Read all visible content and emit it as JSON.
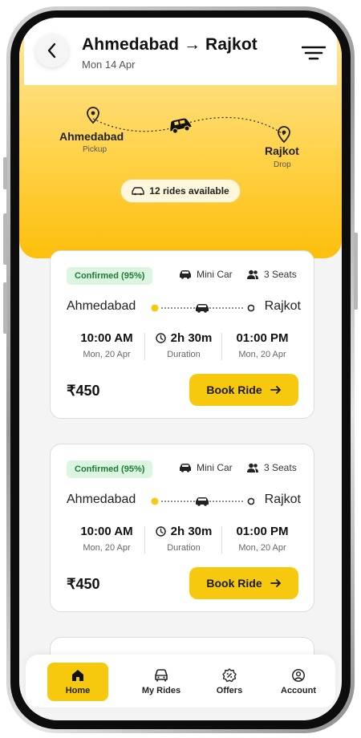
{
  "header": {
    "title": "Ahmedabad → Rajkot",
    "date": "Mon 14 Apr"
  },
  "route_map": {
    "from_city": "Ahmedabad",
    "from_label": "Pickup",
    "to_city": "Rajkot",
    "to_label": "Drop",
    "rides_available": "12 rides available"
  },
  "rides": [
    {
      "status": "Confirmed (95%)",
      "vehicle": "Mini Car",
      "seats": "3 Seats",
      "from": "Ahmedabad",
      "to": "Rajkot",
      "depart_time": "10:00 AM",
      "depart_date": "Mon, 20 Apr",
      "duration": "2h 30m",
      "duration_label": "Duration",
      "arrive_time": "01:00 PM",
      "arrive_date": "Mon, 20 Apr",
      "price": "₹450",
      "book_label": "Book Ride"
    },
    {
      "status": "Confirmed (95%)",
      "vehicle": "Mini Car",
      "seats": "3 Seats",
      "from": "Ahmedabad",
      "to": "Rajkot",
      "depart_time": "10:00 AM",
      "depart_date": "Mon, 20 Apr",
      "duration": "2h 30m",
      "duration_label": "Duration",
      "arrive_time": "01:00 PM",
      "arrive_date": "Mon, 20 Apr",
      "price": "₹450",
      "book_label": "Book Ride"
    }
  ],
  "bottom_nav": {
    "items": [
      {
        "label": "Home",
        "icon": "home-icon",
        "active": true
      },
      {
        "label": "My Rides",
        "icon": "car-icon",
        "active": false
      },
      {
        "label": "Offers",
        "icon": "offer-icon",
        "active": false
      },
      {
        "label": "Account",
        "icon": "account-icon",
        "active": false
      }
    ]
  },
  "colors": {
    "accent": "#f6c90e",
    "hero_top": "#ffe9a6",
    "hero_bottom": "#fcbf0b",
    "badge_bg": "#dbf5e0",
    "badge_text": "#1f7a36",
    "origin_dot": "#f6c90e"
  }
}
